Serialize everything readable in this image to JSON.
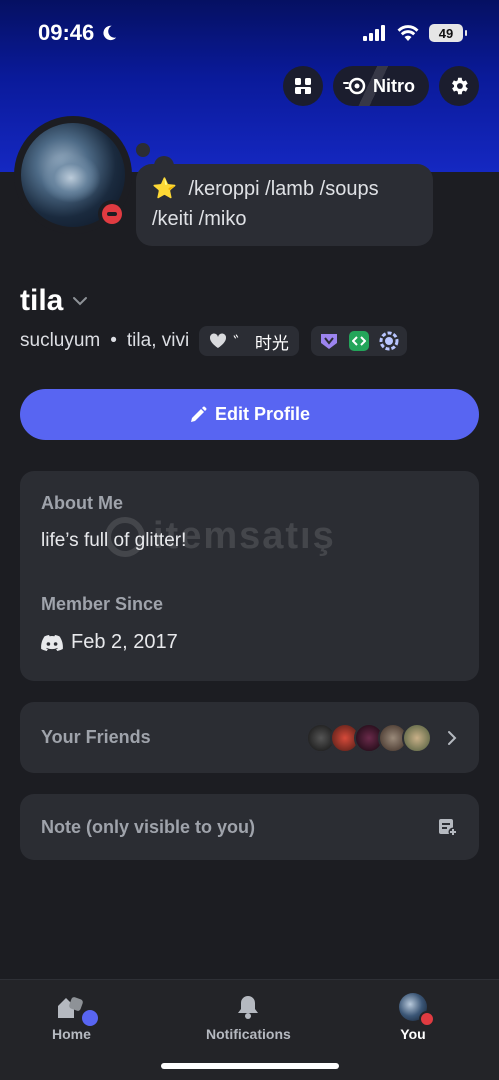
{
  "status_bar": {
    "time": "09:46",
    "battery": "49"
  },
  "header": {
    "nitro_label": "Nitro"
  },
  "profile": {
    "custom_status": "/keroppi /lamb /soups /keiti /miko",
    "display_name": "tila",
    "username": "sucluyum",
    "pronouns": "tila, vivi",
    "tag_text": "゛ 时光",
    "edit_label": "Edit Profile"
  },
  "about": {
    "label": "About Me",
    "text": "life’s full of glitter!",
    "member_since_label": "Member Since",
    "member_since_date": "Feb 2, 2017"
  },
  "friends": {
    "label": "Your Friends"
  },
  "note": {
    "label": "Note (only visible to you)"
  },
  "watermark": {
    "text": "itemsatış"
  },
  "nav": {
    "home": "Home",
    "notifications": "Notifications",
    "you": "You"
  },
  "colors": {
    "accent": "#5865f2",
    "dnd": "#e03b41",
    "banner": "#0a1a9a"
  }
}
